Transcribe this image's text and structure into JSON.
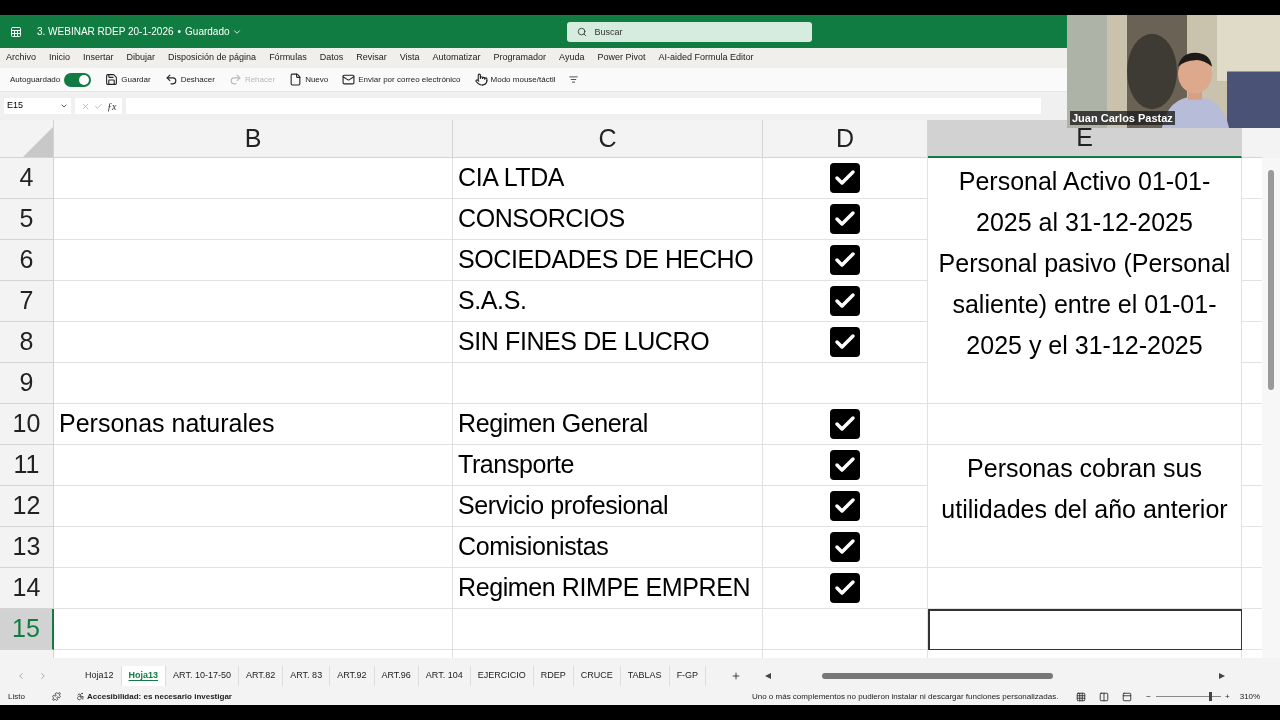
{
  "title_bar": {
    "file_name": "3. WEBINAR RDEP 20-1-2026",
    "separator": "•",
    "save_status": "Guardado",
    "search": {
      "placeholder": "Buscar"
    }
  },
  "menu": [
    {
      "label": "Archivo"
    },
    {
      "label": "Inicio"
    },
    {
      "label": "Insertar"
    },
    {
      "label": "Dibujar"
    },
    {
      "label": "Disposición de página"
    },
    {
      "label": "Fórmulas"
    },
    {
      "label": "Datos"
    },
    {
      "label": "Revisar"
    },
    {
      "label": "Vista"
    },
    {
      "label": "Automatizar"
    },
    {
      "label": "Programador"
    },
    {
      "label": "Ayuda"
    },
    {
      "label": "Power Pivot"
    },
    {
      "label": "AI-aided Formula Editor"
    }
  ],
  "quick_access": {
    "autosave": {
      "label": "Autoguardado",
      "on": true
    },
    "items": [
      {
        "kind": "save",
        "label": "Guardar",
        "disabled": false
      },
      {
        "kind": "undo",
        "label": "Deshacer",
        "disabled": false
      },
      {
        "kind": "redo",
        "label": "Rehacer",
        "disabled": true
      },
      {
        "kind": "new",
        "label": "Nuevo",
        "disabled": false
      },
      {
        "kind": "mail",
        "label": "Enviar por correo electrónico",
        "disabled": false
      },
      {
        "kind": "touch",
        "label": "Modo mouse/táctil",
        "disabled": false
      }
    ]
  },
  "formula_bar": {
    "name_box": "E15",
    "function_label": "ƒx"
  },
  "columns": [
    {
      "label": "B",
      "selected": false
    },
    {
      "label": "C",
      "selected": false
    },
    {
      "label": "D",
      "selected": false
    },
    {
      "label": "E",
      "selected": true
    }
  ],
  "rows": [
    {
      "number": "4",
      "selected": false,
      "c": "CIA LTDA",
      "checkbox": {
        "checked": true
      },
      "e": [
        "Personal Activo 01-01-2025 al 31-12-2025",
        "Personal pasivo (Personal saliente) entre el 01-01-2025 y el 31-12-2025"
      ]
    },
    {
      "number": "5",
      "selected": false,
      "c": "CONSORCIOS",
      "checkbox": {
        "checked": true
      }
    },
    {
      "number": "6",
      "selected": false,
      "c": "SOCIEDADES DE HECHO",
      "checkbox": {
        "checked": true
      }
    },
    {
      "number": "7",
      "selected": false,
      "c": "S.A.S.",
      "checkbox": {
        "checked": true
      }
    },
    {
      "number": "8",
      "selected": false,
      "c": "SIN FINES DE LUCRO",
      "checkbox": {
        "checked": true
      }
    },
    {
      "number": "9",
      "selected": false
    },
    {
      "number": "10",
      "selected": false,
      "b": "Personas naturales",
      "c": "Regimen General",
      "checkbox": {
        "checked": true
      }
    },
    {
      "number": "11",
      "selected": false,
      "c": "Transporte",
      "checkbox": {
        "checked": true
      },
      "e": [
        "Personas cobran sus utilidades del año anterior"
      ]
    },
    {
      "number": "12",
      "selected": false,
      "c": "Servicio profesional",
      "checkbox": {
        "checked": true
      }
    },
    {
      "number": "13",
      "selected": false,
      "c": "Comisionistas",
      "checkbox": {
        "checked": true
      }
    },
    {
      "number": "14",
      "selected": false,
      "c": "Regimen RIMPE EMPREN",
      "checkbox": {
        "checked": true
      }
    },
    {
      "number": "15",
      "selected": true
    }
  ],
  "sheet_tabs": [
    {
      "label": "Hoja12",
      "selected": false
    },
    {
      "label": "Hoja13",
      "selected": true
    },
    {
      "label": "ART. 10-17-50",
      "selected": false
    },
    {
      "label": "ART.82",
      "selected": false
    },
    {
      "label": "ART. 83",
      "selected": false
    },
    {
      "label": "ART.92",
      "selected": false
    },
    {
      "label": "ART.96",
      "selected": false
    },
    {
      "label": "ART. 104",
      "selected": false
    },
    {
      "label": "EJERCICIO",
      "selected": false
    },
    {
      "label": "RDEP",
      "selected": false
    },
    {
      "label": "CRUCE",
      "selected": false
    },
    {
      "label": "TABLAS",
      "selected": false
    },
    {
      "label": "F-GP",
      "selected": false
    }
  ],
  "status_bar": {
    "ready": "Listo",
    "accessibility": "Accesibilidad: es necesario investigar",
    "message": "Uno o más complementos no pudieron instalar ni descargar funciones personalizadas.",
    "zoom": {
      "minus": "−",
      "plus": "+",
      "level": 0.85,
      "reading": "310%"
    }
  },
  "webcam": {
    "kind": "picture",
    "participant": "Juan Carlos Pastaz"
  }
}
